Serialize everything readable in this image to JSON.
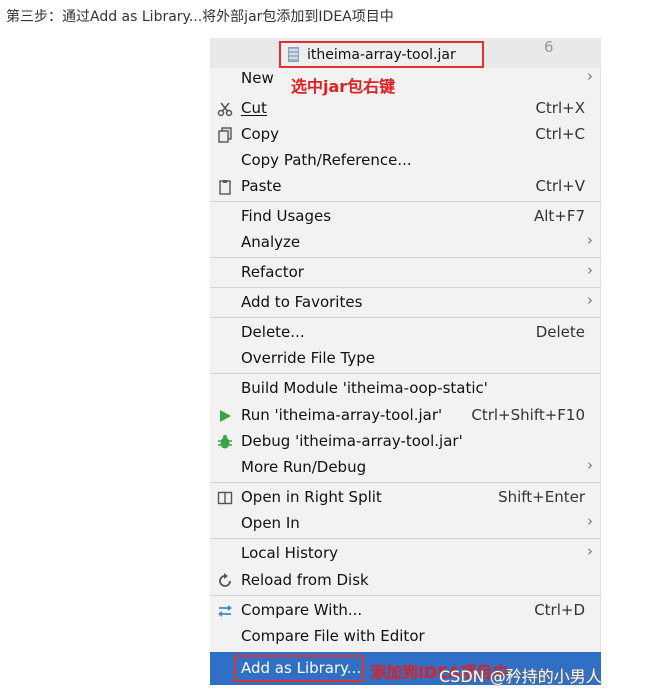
{
  "caption": "第三步：通过Add as Library...将外部jar包添加到IDEA项目中",
  "header": {
    "file_name": "itheima-array-tool.jar",
    "line_number": "6",
    "annotation": "选中jar包右键"
  },
  "menu": {
    "new": {
      "label": "New",
      "arrow": "›"
    },
    "cut": {
      "label": "Cut",
      "shortcut": "Ctrl+X",
      "icon": "scissors-icon"
    },
    "copy": {
      "label": "Copy",
      "shortcut": "Ctrl+C",
      "icon": "copy-icon"
    },
    "copy_path": {
      "label": "Copy Path/Reference..."
    },
    "paste": {
      "label": "Paste",
      "shortcut": "Ctrl+V",
      "icon": "clipboard-icon"
    },
    "find_usages": {
      "label": "Find Usages",
      "shortcut": "Alt+F7"
    },
    "analyze": {
      "label": "Analyze",
      "arrow": "›"
    },
    "refactor": {
      "label": "Refactor",
      "arrow": "›"
    },
    "add_favorites": {
      "label": "Add to Favorites",
      "arrow": "›"
    },
    "delete": {
      "label": "Delete...",
      "shortcut": "Delete"
    },
    "override": {
      "label": "Override File Type"
    },
    "build": {
      "label": "Build Module 'itheima-oop-static'"
    },
    "run": {
      "label": "Run 'itheima-array-tool.jar'",
      "shortcut": "Ctrl+Shift+F10",
      "icon": "play-icon"
    },
    "debug": {
      "label": "Debug 'itheima-array-tool.jar'",
      "icon": "bug-icon"
    },
    "more_run": {
      "label": "More Run/Debug",
      "arrow": "›"
    },
    "open_right": {
      "label": "Open in Right Split",
      "shortcut": "Shift+Enter",
      "icon": "split-icon"
    },
    "open_in": {
      "label": "Open In",
      "arrow": "›"
    },
    "local_history": {
      "label": "Local History",
      "arrow": "›"
    },
    "reload": {
      "label": "Reload from Disk",
      "icon": "reload-icon"
    },
    "compare_with": {
      "label": "Compare With...",
      "shortcut": "Ctrl+D",
      "icon": "compare-icon"
    },
    "compare_editor": {
      "label": "Compare File with Editor"
    },
    "add_library": {
      "label": "Add as Library...",
      "annotation": "添加到IDEA项目中"
    }
  },
  "watermark": "CSDN @矜持的小男人",
  "colors": {
    "selection": "#2f6fc6",
    "annotation": "#e02020",
    "menu_bg": "#f2f2f2"
  }
}
